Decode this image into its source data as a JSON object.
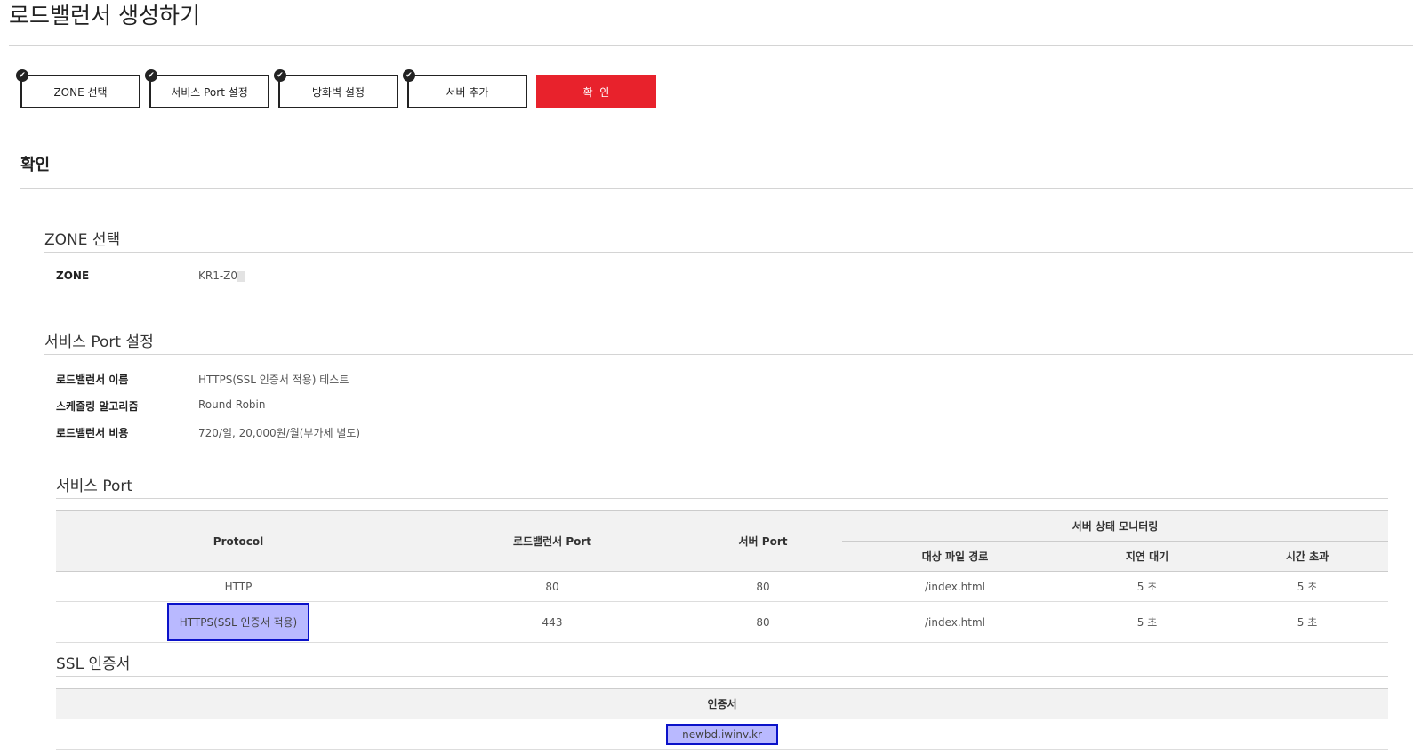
{
  "page_title": "로드밸런서 생성하기",
  "steps": [
    {
      "label": "ZONE 선택",
      "done": true
    },
    {
      "label": "서비스 Port 설정",
      "done": true
    },
    {
      "label": "방화벽 설정",
      "done": true
    },
    {
      "label": "서버 추가",
      "done": true
    },
    {
      "label": "확  인",
      "active": true
    }
  ],
  "confirm_heading": "확인",
  "zone_section": {
    "title": "ZONE 선택",
    "label": "ZONE",
    "value": "KR1-Z0"
  },
  "service_section": {
    "title": "서비스 Port 설정",
    "rows": [
      {
        "label": "로드밸런서 이름",
        "value": "HTTPS(SSL 인증서 적용) 테스트"
      },
      {
        "label": "스케줄링 알고리즘",
        "value": "Round Robin"
      },
      {
        "label": "로드밸런서 비용",
        "value": "720/일, 20,000원/월(부가세 별도)"
      }
    ]
  },
  "port_section": {
    "title": "서비스 Port",
    "headers": {
      "protocol": "Protocol",
      "lb_port": "로드밸런서 Port",
      "server_port": "서버 Port",
      "monitoring": "서버 상태 모니터링",
      "path": "대상 파일 경로",
      "delay": "지연 대기",
      "timeout": "시간 초과"
    },
    "rows": [
      {
        "protocol": "HTTP",
        "lb_port": "80",
        "server_port": "80",
        "path": "/index.html",
        "delay": "5 초",
        "timeout": "5 초"
      },
      {
        "protocol": "HTTPS(SSL 인증서 적용)",
        "lb_port": "443",
        "server_port": "80",
        "path": "/index.html",
        "delay": "5 초",
        "timeout": "5 초"
      }
    ]
  },
  "ssl_section": {
    "title": "SSL 인증서",
    "header": "인증서",
    "value": "newbd.iwinv.kr"
  },
  "colors": {
    "accent": "#e8222c",
    "highlight_fill": "#b9b9ff",
    "highlight_border": "#0b12c9"
  },
  "icons": {
    "step_check": "check-circle-icon"
  }
}
